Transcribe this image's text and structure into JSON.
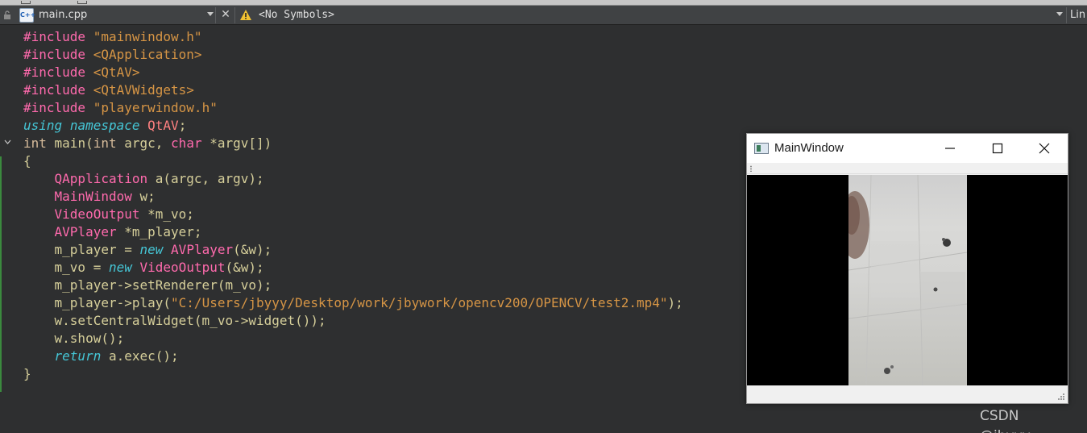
{
  "editor": {
    "file_name": "main.cpp",
    "symbols": "<No Symbols>",
    "line_col": "Lin",
    "lines": [
      [
        {
          "t": "#include ",
          "c": "pp"
        },
        {
          "t": "\"mainwindow.h\"",
          "c": "str"
        }
      ],
      [
        {
          "t": "#include ",
          "c": "pp"
        },
        {
          "t": "<QApplication>",
          "c": "str"
        }
      ],
      [
        {
          "t": "#include ",
          "c": "pp"
        },
        {
          "t": "<QtAV>",
          "c": "str"
        }
      ],
      [
        {
          "t": "#include ",
          "c": "pp"
        },
        {
          "t": "<QtAVWidgets>",
          "c": "str"
        }
      ],
      [
        {
          "t": "#include ",
          "c": "pp"
        },
        {
          "t": "\"playerwindow.h\"",
          "c": "str"
        }
      ],
      [
        {
          "t": "using",
          "c": "kw-it"
        },
        {
          "t": " "
        },
        {
          "t": "namespace",
          "c": "kw-it"
        },
        {
          "t": " "
        },
        {
          "t": "QtAV",
          "c": "ns"
        },
        {
          "t": ";"
        }
      ],
      [
        {
          "t": "int",
          "c": "kw"
        },
        {
          "t": " main("
        },
        {
          "t": "int",
          "c": "kw"
        },
        {
          "t": " argc, "
        },
        {
          "t": "char",
          "c": "type"
        },
        {
          "t": " *argv[])"
        }
      ],
      [
        {
          "t": "{"
        }
      ],
      [
        {
          "t": "    "
        },
        {
          "t": "QApplication",
          "c": "type"
        },
        {
          "t": " a(argc, argv);"
        }
      ],
      [
        {
          "t": "    "
        },
        {
          "t": "MainWindow",
          "c": "type"
        },
        {
          "t": " w;"
        }
      ],
      [
        {
          "t": "    "
        },
        {
          "t": "VideoOutput",
          "c": "type"
        },
        {
          "t": " *m_vo;"
        }
      ],
      [
        {
          "t": "    "
        },
        {
          "t": "AVPlayer",
          "c": "type"
        },
        {
          "t": " *m_player;"
        }
      ],
      [
        {
          "t": "    m_player = "
        },
        {
          "t": "new",
          "c": "kw-it"
        },
        {
          "t": " "
        },
        {
          "t": "AVPlayer",
          "c": "type"
        },
        {
          "t": "(&w);"
        }
      ],
      [
        {
          "t": "    m_vo = "
        },
        {
          "t": "new",
          "c": "kw-it"
        },
        {
          "t": " "
        },
        {
          "t": "VideoOutput",
          "c": "type"
        },
        {
          "t": "(&w);"
        }
      ],
      [
        {
          "t": "    m_player->setRenderer(m_vo);"
        }
      ],
      [
        {
          "t": "    m_player->play("
        },
        {
          "t": "\"C:/Users/jbyyy/Desktop/work/jbywork/opencv200/OPENCV/test2.mp4\"",
          "c": "str"
        },
        {
          "t": ");"
        }
      ],
      [
        {
          "t": "    w.setCentralWidget(m_vo->widget());"
        }
      ],
      [
        {
          "t": "    w.show();"
        }
      ],
      [
        {
          "t": "    "
        },
        {
          "t": "return",
          "c": "kw-it"
        },
        {
          "t": " a.exec();"
        }
      ],
      [
        {
          "t": "}"
        }
      ]
    ]
  },
  "qt_window": {
    "title": "MainWindow"
  },
  "icons": {
    "file": "cpp-file-icon",
    "warning": "warning-icon",
    "lock": "lock-icon"
  },
  "file_icon_text": "C++",
  "watermark": "CSDN @jbyyy、"
}
